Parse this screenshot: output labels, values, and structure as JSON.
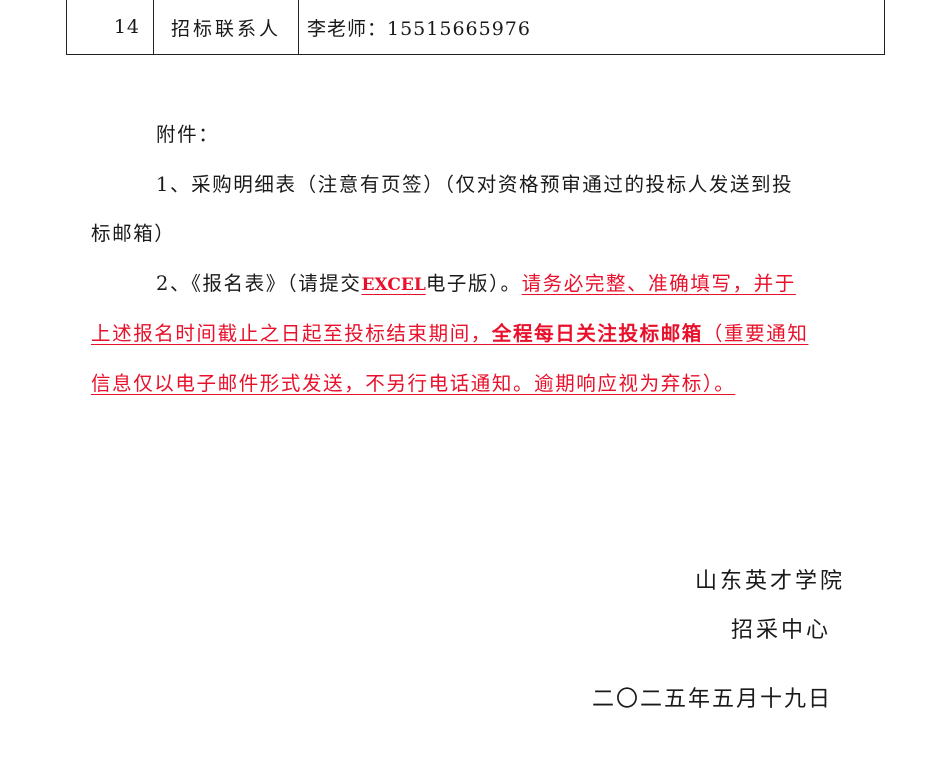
{
  "table": {
    "row": {
      "no": "14",
      "item": "招标联系人",
      "value": "李老师：15515665976"
    }
  },
  "attachments": {
    "heading": "附件：",
    "item1_line1": "1、采购明细表（注意有页签）（仅对资格预审通过的投标人发送到投",
    "item1_line2": "标邮箱）",
    "item2_prefix": "2、《报名表》（请提交",
    "item2_excel": "EXCEL",
    "item2_suffix": "电子版）。",
    "item2_red_1": "请务必完整、准确填写，并于",
    "item2_red_2a": "上述报名时间截止之日起至投标结束期间，",
    "item2_red_2b": "全程每日关注投标邮箱",
    "item2_red_2c": "（重要通知",
    "item2_red_3": "信息仅以电子邮件形式发送，不另行电话通知。逾期响应视为弃标）。"
  },
  "signature": {
    "org": "山东英才学院",
    "dept": "招采中心",
    "date": "二〇二五年五月十九日"
  },
  "colors": {
    "red_text": "#e8102a",
    "border": "#222222"
  }
}
